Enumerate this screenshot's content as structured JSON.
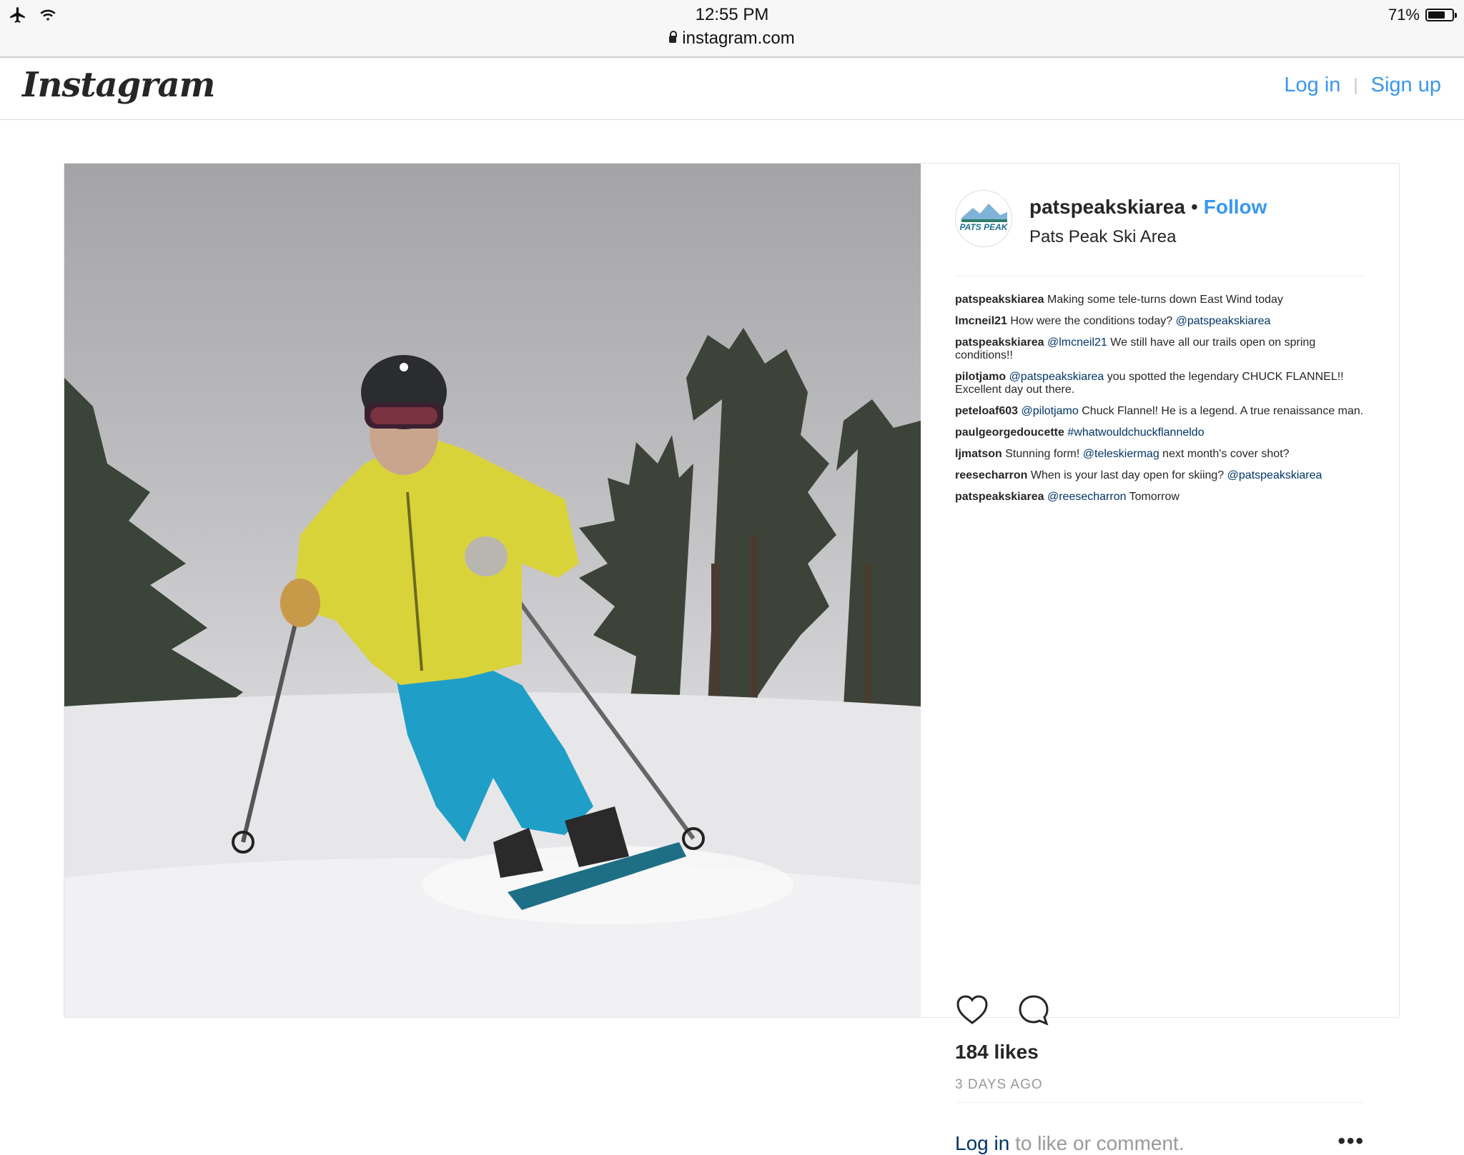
{
  "status_bar": {
    "time": "12:55 PM",
    "url": "instagram.com",
    "battery": "71%",
    "battery_level": 0.71
  },
  "header": {
    "logo": "Instagram",
    "login": "Log in",
    "separator": "|",
    "signup": "Sign up"
  },
  "post": {
    "username": "patspeakskiarea",
    "follow": "Follow",
    "location": "Pats Peak Ski Area",
    "avatar_text": "PATS PEAK",
    "likes": "184 likes",
    "time_ago": "3 DAYS AGO",
    "login_link": "Log in",
    "login_rest": "to like or comment.",
    "comments": [
      {
        "user": "patspeakskiarea",
        "mention": "",
        "text": "Making some tele-turns down East Wind today"
      },
      {
        "user": "lmcneil21",
        "mention": "@patspeakskiarea",
        "text": "How were the conditions today?"
      },
      {
        "user": "patspeakskiarea",
        "mention": "@lmcneil21",
        "text": "We still have all our trails open on spring conditions!!"
      },
      {
        "user": "pilotjamo",
        "mention": "@patspeakskiarea",
        "text": "you spotted the legendary CHUCK FLANNEL!! Excellent day out there."
      },
      {
        "user": "peteloaf603",
        "mention": "@pilotjamo",
        "text": "Chuck Flannel! He is a legend. A true renaissance man."
      },
      {
        "user": "paulgeorgedoucette",
        "mention": "#whatwouldchuckflanneldo",
        "text": ""
      },
      {
        "user": "ljmatson",
        "mention": "@teleskiermag",
        "text": "Stunning form!",
        "text2": "next month's cover shot?"
      },
      {
        "user": "reesecharron",
        "mention": "@patspeakskiarea",
        "text": "When is your last day open for skiing?"
      },
      {
        "user": "patspeakskiarea",
        "mention": "@reesecharron",
        "text": "Tomorrow"
      }
    ]
  },
  "icons": {
    "airplane": "airplane-icon",
    "wifi": "wifi-icon",
    "lock": "lock-icon",
    "battery": "battery-icon",
    "heart": "heart-icon",
    "comment": "comment-icon",
    "more": "more-options-icon"
  },
  "colors": {
    "link_blue": "#3897f0",
    "mention_blue": "#003569",
    "text": "#262626",
    "muted": "#999999"
  }
}
